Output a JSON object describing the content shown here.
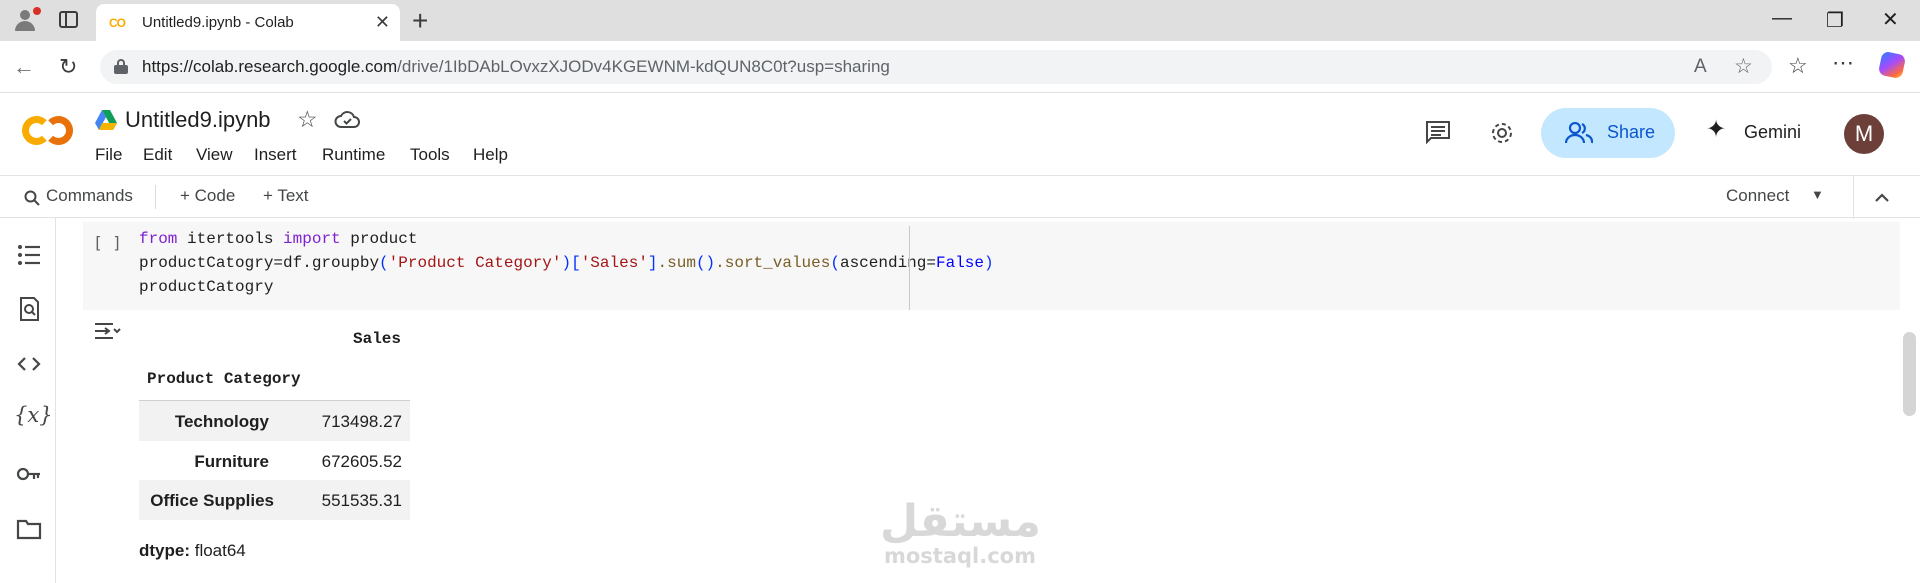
{
  "browser": {
    "tab_title": "Untitled9.ipynb - Colab",
    "tab_favicon": "CO",
    "url_host": "https://colab.research.google.com",
    "url_path": "/drive/1IbDAbLOvxzXJODv4KGEWNM-kdQUN8C0t?usp=sharing",
    "new_tab_label": "+",
    "close_tab_label": "✕"
  },
  "colab": {
    "notebook_title": "Untitled9.ipynb",
    "menus": [
      "File",
      "Edit",
      "View",
      "Insert",
      "Runtime",
      "Tools",
      "Help"
    ],
    "share_label": "Share",
    "gemini_label": "Gemini",
    "avatar_initial": "M",
    "colors": {
      "logo_orange": "#f9ab00",
      "logo_dark_orange": "#e8710a",
      "share_bg": "#c2e7ff",
      "share_text": "#0b57d0",
      "avatar_bg": "#6d3f39"
    }
  },
  "toolbar": {
    "commands_label": "Commands",
    "code_label": "+ Code",
    "text_label": "+ Text",
    "connect_label": "Connect"
  },
  "cell": {
    "run_bracket": "[ ]",
    "code": {
      "l1_kw1": "from",
      "l1_mod": " itertools ",
      "l1_kw2": "import",
      "l1_name": " product",
      "l2_a": "productCatogry=df.groupby",
      "l2_p1": "(",
      "l2_s1": "'Product Category'",
      "l2_p2": ")",
      "l2_b1": "[",
      "l2_s2": "'Sales'",
      "l2_b2": "]",
      "l2_dot1": ".sum",
      "l2_p3": "()",
      "l2_dot2": ".sort_values",
      "l2_p4": "(",
      "l2_arg": "ascending=",
      "l2_const": "False",
      "l2_p5": ")",
      "l3": "productCatogry"
    }
  },
  "output": {
    "column_header": "Sales",
    "index_header": "Product Category",
    "rows": [
      {
        "category": "Technology",
        "value": "713498.27"
      },
      {
        "category": "Furniture",
        "value": "672605.52"
      },
      {
        "category": "Office Supplies",
        "value": "551535.31"
      }
    ],
    "dtype_label": "dtype:",
    "dtype_value": " float64"
  },
  "watermark": {
    "arabic": "مستقل",
    "latin": "mostaql.com"
  }
}
